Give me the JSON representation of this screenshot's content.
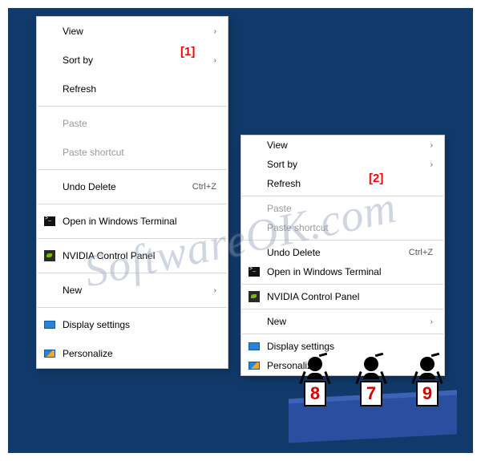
{
  "annotations": {
    "one": "[1]",
    "two": "[2]"
  },
  "watermark": "SoftwareOK.com",
  "judges": {
    "scores": [
      "8",
      "7",
      "9"
    ]
  },
  "menu1": {
    "view": "View",
    "sortby": "Sort by",
    "refresh": "Refresh",
    "paste": "Paste",
    "paste_shortcut": "Paste shortcut",
    "undo_delete": "Undo Delete",
    "undo_delete_shortcut": "Ctrl+Z",
    "open_terminal": "Open in Windows Terminal",
    "nvidia": "NVIDIA Control Panel",
    "new": "New",
    "display_settings": "Display settings",
    "personalize": "Personalize"
  },
  "menu2": {
    "view": "View",
    "sortby": "Sort by",
    "refresh": "Refresh",
    "paste": "Paste",
    "paste_shortcut": "Paste shortcut",
    "undo_delete": "Undo Delete",
    "undo_delete_shortcut": "Ctrl+Z",
    "open_terminal": "Open in Windows Terminal",
    "nvidia": "NVIDIA Control Panel",
    "new": "New",
    "display_settings": "Display settings",
    "personalize": "Personalize"
  }
}
